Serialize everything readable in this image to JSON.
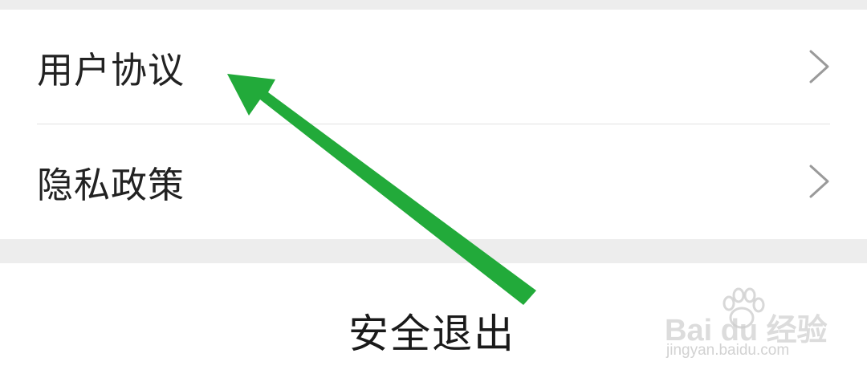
{
  "settings": {
    "items": [
      {
        "label": "用户协议",
        "icon": "chevron-right-icon"
      },
      {
        "label": "隐私政策",
        "icon": "chevron-right-icon"
      }
    ]
  },
  "logout": {
    "label": "安全退出"
  },
  "annotation": {
    "icon": "arrow-icon",
    "color": "#22aa3a"
  },
  "watermark": {
    "logo_text": "Bai du 经验",
    "url": "jingyan.baidu.com"
  },
  "colors": {
    "background": "#ededed",
    "panel": "#ffffff",
    "text": "#222222",
    "chevron": "#9a9a9a",
    "divider": "#e2e2e2"
  }
}
